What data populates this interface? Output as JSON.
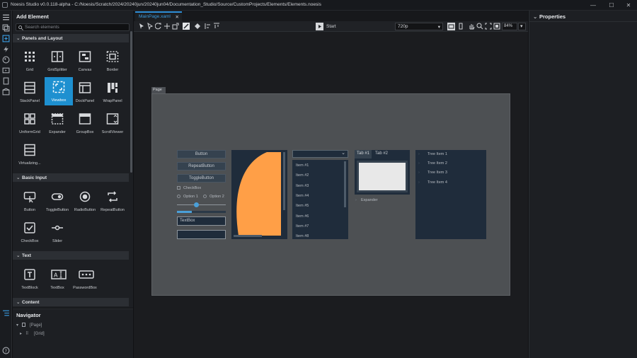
{
  "window": {
    "title": "Noesis Studio v0.0.118-alpha - C:/Noesis/Scratch/2024/20240jun/20240jun04/Documentation_Studio/Source/CustomProjects/Elements/Elements.noesis"
  },
  "add_element": {
    "title": "Add Element",
    "search_placeholder": "Search elements",
    "categories": [
      {
        "name": "Panels and Layout",
        "items": [
          "Grid",
          "GridSplitter",
          "Canvas",
          "Border",
          "StackPanel",
          "Viewbox",
          "DockPanel",
          "WrapPanel",
          "UniformGrid",
          "Expander",
          "GroupBox",
          "ScrollViewer",
          "Virtualizing..."
        ]
      },
      {
        "name": "Basic Input",
        "items": [
          "Button",
          "ToggleButton",
          "RadioButton",
          "RepeatButton",
          "CheckBox",
          "Slider"
        ]
      },
      {
        "name": "Text",
        "items": [
          "TextBlock",
          "TextBox",
          "PasswordBox"
        ]
      },
      {
        "name": "Content",
        "items": []
      }
    ],
    "selected_item": "Viewbox"
  },
  "navigator": {
    "title": "Navigator",
    "nodes": [
      "[Page]",
      "[Grid]"
    ]
  },
  "editor": {
    "tab_label": "MainPage.xaml",
    "tab_close": "✕",
    "start_label": "Start",
    "resolution": "720p",
    "zoom": "84%"
  },
  "page": {
    "tag": "Page",
    "buttons": [
      "Button",
      "RepeatButton",
      "ToggleButton"
    ],
    "checkbox_label": "CheckBox",
    "radio_options": [
      "Option 1",
      "Option 2"
    ],
    "slider_value": 0.4,
    "progress_value": 0.3,
    "textbox_value": "TextBox",
    "list_items": [
      "Item #1",
      "Item #2",
      "Item #3",
      "Item #4",
      "Item #5",
      "Item #6",
      "Item #7",
      "Item #8"
    ],
    "tabs": [
      "Tab #1",
      "Tab #2"
    ],
    "expander_label": "Expander",
    "tree_items": [
      "Tree Item 1",
      "Tree Item 2",
      "Tree Item 3",
      "Tree Item 4"
    ],
    "accent": "#ff9f47"
  },
  "properties": {
    "title": "Properties"
  },
  "colors": {
    "accent": "#1e90d0",
    "tab_accent": "#2f8fd8"
  }
}
